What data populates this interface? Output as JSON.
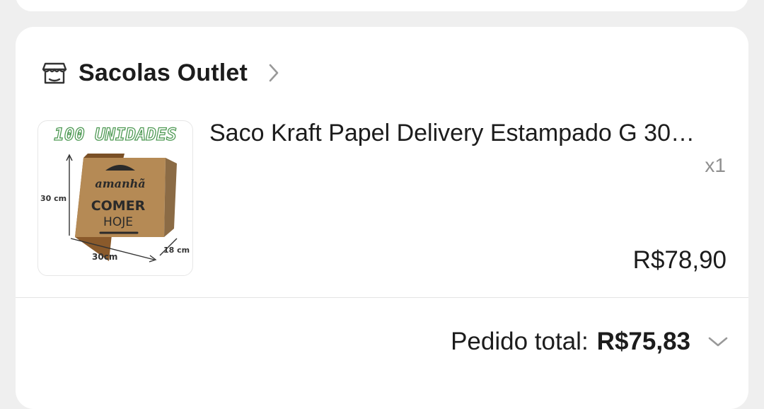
{
  "shop": {
    "name": "Sacolas Outlet",
    "icon": "store-icon"
  },
  "product": {
    "title": "Saco Kraft Papel Delivery Estampado G 30…",
    "quantity": "x1",
    "price": "R$78,90",
    "image": {
      "banner": "100 UNIDADES",
      "height_label": "30 cm",
      "width_label": "30cm",
      "depth_label": "18 cm",
      "bag_text_1": "amanhã",
      "bag_text_2": "COMER",
      "bag_text_3": "HOJE"
    }
  },
  "order": {
    "total_label": "Pedido total:",
    "total_value": "R$75,83"
  },
  "colors": {
    "card": "#ffffff",
    "page_background": "#efefef",
    "kraft": "#b58a55",
    "banner_green": "#4f9a55"
  }
}
